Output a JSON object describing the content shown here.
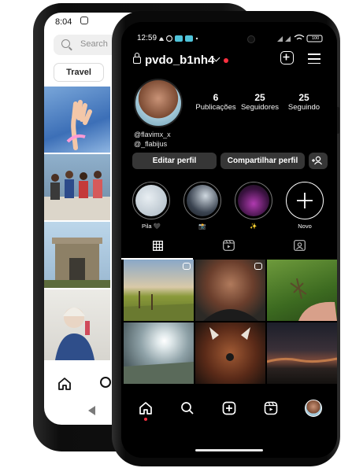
{
  "back_phone": {
    "status_time": "8:04",
    "search_placeholder": "Search",
    "chip": "Travel"
  },
  "front_phone": {
    "status_time": "12:59",
    "battery": "100",
    "profile": {
      "username": "pvdo_b1nh4",
      "stats": [
        {
          "value": "6",
          "label": "Publicações"
        },
        {
          "value": "25",
          "label": "Seguidores"
        },
        {
          "value": "25",
          "label": "Seguindo"
        }
      ],
      "bio_lines": [
        "@flavimx_x",
        "@_flabijus"
      ],
      "edit_button": "Editar perfil",
      "share_button": "Compartilhar perfil"
    },
    "highlights": [
      {
        "label": "Pila 🖤"
      },
      {
        "label": "📸"
      },
      {
        "label": "✨"
      },
      {
        "label": "Novo"
      }
    ],
    "tabs": [
      "grid-icon",
      "reels-icon",
      "tagged-icon"
    ],
    "bottom_nav": [
      "home-icon",
      "search-icon",
      "create-icon",
      "reels-icon",
      "profile-avatar"
    ],
    "colors": {
      "accent_live": "#ff3040",
      "button_bg": "#363636"
    }
  }
}
